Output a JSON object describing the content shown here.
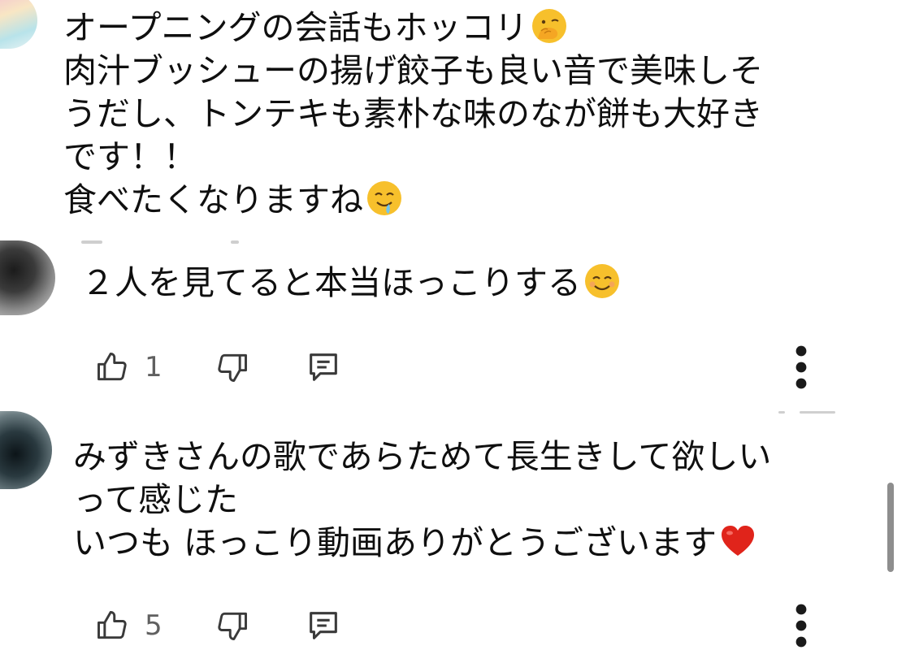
{
  "comments": [
    {
      "text": "オープニングの会話もホッコリ",
      "text_lines": [
        "オープニングの会話もホッコリ",
        "肉汁ブッシューの揚げ餃子も良い音で美味しそ",
        "うだし、トンテキも素朴な味のなが餅も大好き",
        "です！！",
        "食べたくなりますね"
      ],
      "emojis": [
        "hand-over-mouth-emoji",
        "drooling-face-emoji"
      ]
    },
    {
      "text": "２人を見てると本当ほっこりする",
      "emoji": "smiling-face-emoji",
      "like_count": "1"
    },
    {
      "text_lines": [
        "みずきさんの歌であらためて長生きして欲しい",
        "って感じた",
        "いつも ほっこり動画ありがとうございます"
      ],
      "emoji": "red-heart-emoji",
      "like_count": "5"
    }
  ],
  "icons": {
    "like": "thumbs-up-icon",
    "dislike": "thumbs-down-icon",
    "reply": "comment-icon",
    "more": "more-vertical-icon"
  },
  "colors": {
    "text": "#0f0f0f",
    "secondary_text": "#606060",
    "icon": "#3a3a3a",
    "heart": "#e0241b",
    "emoji_face": "#f7c02c"
  }
}
